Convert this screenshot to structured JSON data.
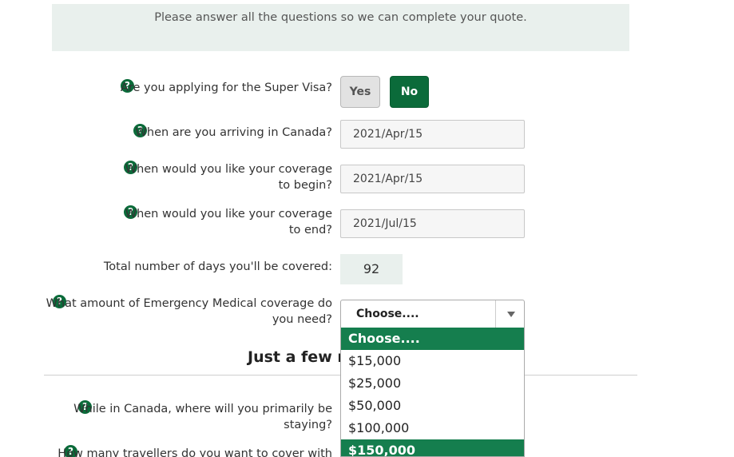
{
  "notice": "Please answer all the questions so we can complete your quote.",
  "help_glyph": "?",
  "questions": {
    "super_visa": {
      "label": "Are you applying for the Super Visa?",
      "yes": "Yes",
      "no": "No",
      "selected": "No"
    },
    "arrival": {
      "label": "When are you arriving in Canada?",
      "value": "2021/Apr/15"
    },
    "coverage_begin": {
      "label_line1": "When would you like your coverage",
      "label_line2": "to begin?",
      "value": "2021/Apr/15"
    },
    "coverage_end": {
      "label_line1": "When would you like your coverage",
      "label_line2": "to end?",
      "value": "2021/Jul/15"
    },
    "total_days": {
      "label": "Total number of days you'll be covered:",
      "value": "92"
    },
    "emergency_medical": {
      "label_line1": "What amount of Emergency Medical coverage do",
      "label_line2": "you need?",
      "selected": "Choose....",
      "options": [
        "Choose....",
        "$15,000",
        "$25,000",
        "$50,000",
        "$100,000",
        "$150,000"
      ],
      "highlighted": [
        "Choose....",
        "$150,000"
      ]
    },
    "stay": {
      "label_line1": "While in Canada, where will you primarily be",
      "label_line2": "staying?"
    },
    "travellers": {
      "label": "How many travellers do you want to cover with"
    }
  },
  "section_title": "Just a few m",
  "colors": {
    "brand_green": "#0b6b3a",
    "highlight_green": "#157e4e",
    "panel_bg": "#e9f0ed"
  }
}
